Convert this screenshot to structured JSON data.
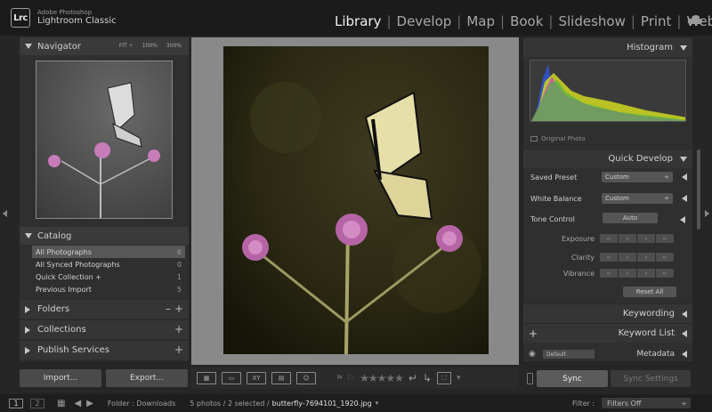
{
  "app": {
    "brand_line1": "Adobe Photoshop",
    "brand_line2": "Lightroom Classic",
    "logo": "Lrc"
  },
  "modules": [
    "Library",
    "Develop",
    "Map",
    "Book",
    "Slideshow",
    "Print",
    "Web"
  ],
  "active_module": "Library",
  "navigator": {
    "title": "Navigator",
    "fit": "FIT ÷",
    "z1": "100%",
    "z2": "300%"
  },
  "catalog": {
    "title": "Catalog",
    "items": [
      {
        "label": "All Photographs",
        "count": "6"
      },
      {
        "label": "All Synced Photographs",
        "count": "0"
      },
      {
        "label": "Quick Collection +",
        "count": "1"
      },
      {
        "label": "Previous Import",
        "count": "5"
      }
    ]
  },
  "left_sections": {
    "folders": "Folders",
    "collections": "Collections",
    "publish": "Publish Services"
  },
  "left_buttons": {
    "import": "Import...",
    "export": "Export..."
  },
  "right": {
    "histogram": "Histogram",
    "original_photo": "Original Photo",
    "quick_develop": "Quick Develop",
    "saved_preset": {
      "label": "Saved Preset",
      "value": "Custom"
    },
    "white_balance": {
      "label": "White Balance",
      "value": "Custom"
    },
    "tone_control": {
      "label": "Tone Control",
      "auto": "Auto"
    },
    "adjust": [
      "Exposure",
      "Clarity",
      "Vibrance"
    ],
    "reset_all": "Reset All",
    "keywording": "Keywording",
    "keyword_list": "Keyword List",
    "metadata": "Metadata",
    "metadata_preset": "Default"
  },
  "sync": {
    "sync": "Sync",
    "sync_settings": "Sync Settings"
  },
  "filmstrip": {
    "page1": "1",
    "page2": "2",
    "folder": "Folder : Downloads",
    "count": "5 photos / 2 selected /",
    "filename": "butterfly-7694101_1920.jpg",
    "filter_label": "Filter :",
    "filter_value": "Filters Off"
  },
  "colors": {
    "accent": "#f0f0f0",
    "panel": "#2f2f2f",
    "background": "#262626"
  }
}
